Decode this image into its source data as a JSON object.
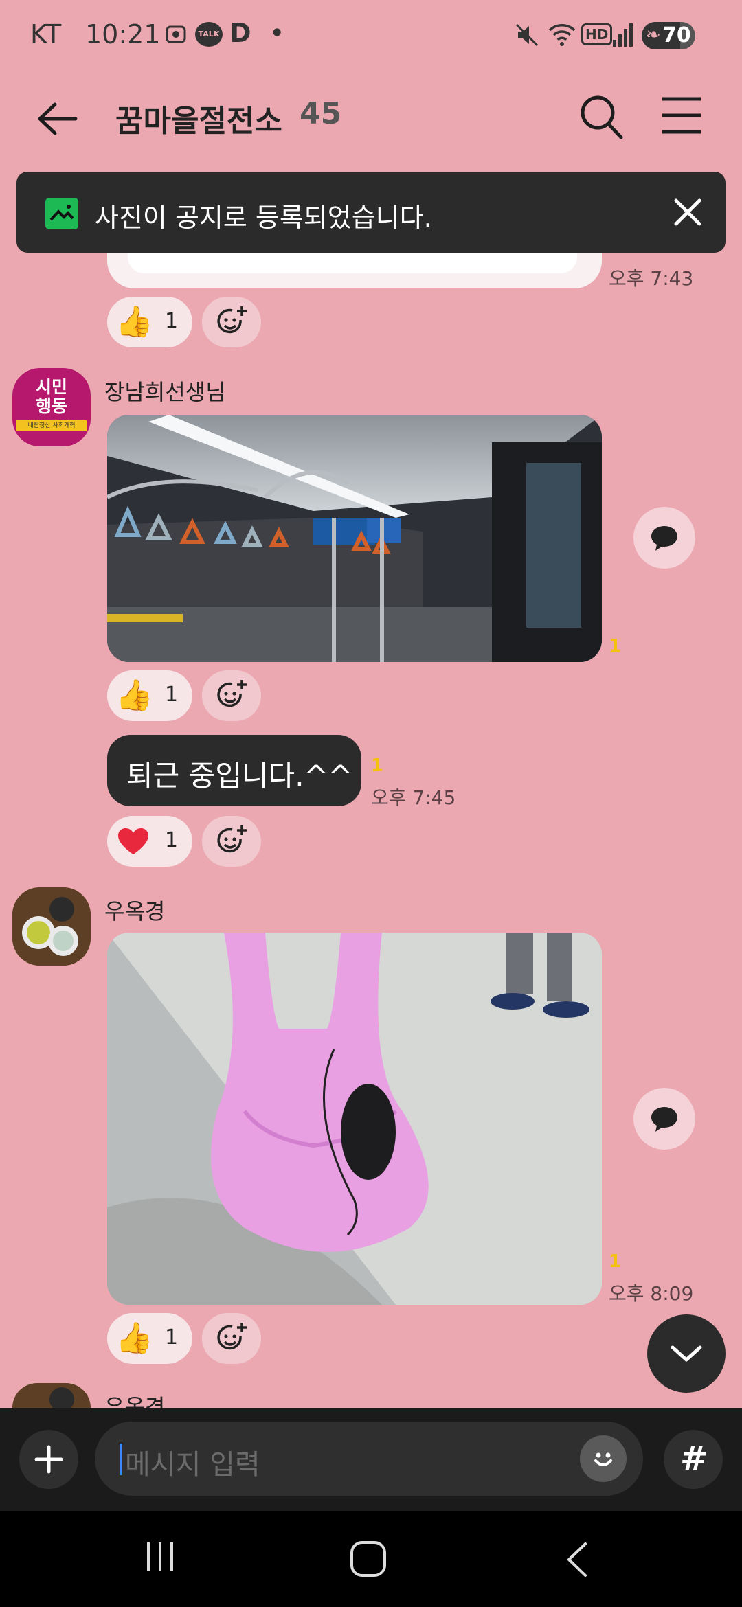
{
  "status_bar": {
    "carrier": "KT",
    "time": "10:21",
    "talk_badge": "TALK",
    "d_badge": "D",
    "dot": "•",
    "hd": "HD",
    "battery": "70"
  },
  "header": {
    "title": "꿈마을절전소",
    "member_count": "45"
  },
  "toast": {
    "message": "사진이 공지로 등록되었습니다."
  },
  "messages": {
    "prev": {
      "time": "오후 7:43",
      "reaction_count": "1"
    },
    "jang": {
      "sender": "장남희선생님",
      "avatar_lines": [
        "시민",
        "행동"
      ],
      "avatar_footer": "내란청산 사회개혁",
      "photo_unread": "1",
      "photo_reaction_count": "1",
      "text": "퇴근 중입니다.^^",
      "text_unread": "1",
      "text_time": "오후 7:45",
      "text_reaction_count": "1"
    },
    "woo": {
      "sender": "우옥경",
      "photo_unread": "1",
      "photo_time": "오후 8:09",
      "photo_reaction_count": "1"
    },
    "woo_next": {
      "sender": "우옥경"
    }
  },
  "input": {
    "placeholder": "메시지 입력",
    "hashtag": "#"
  },
  "colors": {
    "background": "#ECA8B1",
    "toast_bg": "#2b2b2b",
    "toast_icon": "#1db954",
    "unread": "#f4c20d",
    "heart": "#e8283c"
  }
}
